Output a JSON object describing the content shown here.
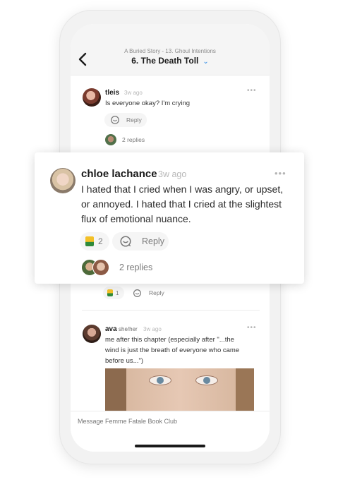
{
  "header": {
    "breadcrumb": "A Buried Story - 13. Ghoul Intentions",
    "title": "6. The Death Toll"
  },
  "comments": {
    "tleis": {
      "username": "tleis",
      "time": "3w ago",
      "text": "Is everyone okay? I'm crying",
      "reply_label": "Reply",
      "replies_label": "2 replies"
    },
    "featured": {
      "username": "chloe lachance",
      "time": "3w ago",
      "text_lines": [
        "I hated that I cried when I was angry, or upset,",
        "or annoyed. I hated that I cried at the slightest",
        "flux of emotional nuance."
      ],
      "reaction_count": "2",
      "reply_label": "Reply",
      "replies_label": "2 replies"
    },
    "hidden_row": {
      "reaction_count": "1",
      "reply_label": "Reply"
    },
    "ava": {
      "username": "ava",
      "pronouns": "she/her",
      "time": "3w ago",
      "text_lines": [
        "me after this chapter (especially after \"...the",
        "wind is just the breath of everyone who came",
        "before us...\")"
      ]
    }
  },
  "composer": {
    "placeholder": "Message Femme Fatale Book Club"
  },
  "colors": {
    "accent": "#2f8be6",
    "muted": "#b8b8b8"
  },
  "icons": [
    "back-chevron-icon",
    "dropdown-chevron-icon",
    "more-icon",
    "reply-icon",
    "clap-icon"
  ]
}
